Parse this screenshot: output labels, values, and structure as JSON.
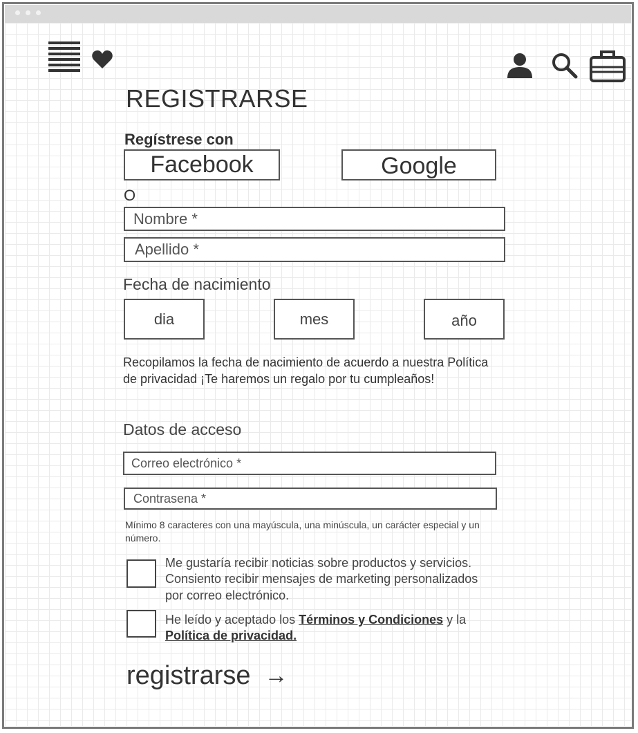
{
  "header": {
    "icons": [
      "menu-icon",
      "heart-icon",
      "user-icon",
      "search-icon",
      "cart-icon"
    ]
  },
  "page": {
    "title": "REGISTRARSE",
    "social_heading": "Regístrese con",
    "facebook_label": "Facebook",
    "google_label": "Google",
    "or_label": "O"
  },
  "form": {
    "first_name_placeholder": "Nombre *",
    "last_name_placeholder": "Apellido *",
    "birthdate_label": "Fecha de nacimiento",
    "day_label": "dia",
    "month_label": "mes",
    "year_label": "año",
    "birthdate_note": "Recopilamos la fecha de nacimiento de acuerdo a nuestra Política de privacidad ¡Te haremos un regalo por tu cumpleaños!",
    "access_heading": "Datos de acceso",
    "email_placeholder": "Correo electrónico *",
    "password_placeholder": "Contrasena *",
    "password_hint": "Mínimo 8 caracteres con una mayúscula, una minúscula, un carácter especial y un número.",
    "newsletter_text": "Me gustaría recibir noticias sobre productos y servicios. Consiento recibir mensajes de marketing personalizados por correo electrónico.",
    "terms_prefix": "He leído y aceptado los ",
    "terms_link": "Términos y Condiciones",
    "terms_mid": " y la",
    "privacy_link": "Política de privacidad.",
    "submit_label": "registrarse",
    "submit_arrow": "→"
  },
  "colors": {
    "stroke": "#555555",
    "text": "#333333",
    "grid": "#eaeaea",
    "titlebar": "#d9d9d9"
  }
}
